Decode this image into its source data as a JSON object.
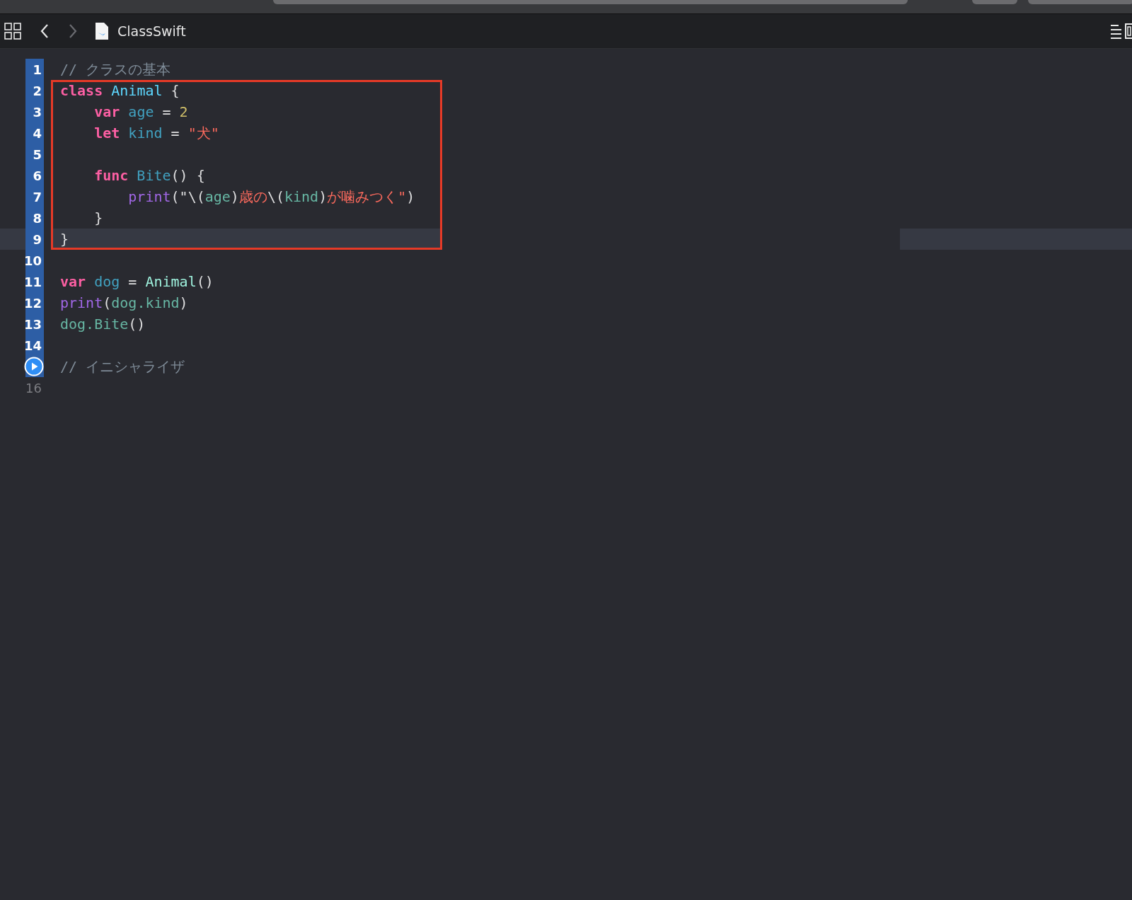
{
  "toolbar": {
    "back_disabled": false,
    "forward_disabled": true,
    "file_name": "ClassSwift"
  },
  "editor": {
    "blocks": [
      {
        "boxed": false,
        "lines": [
          {
            "number": "1",
            "selected": true,
            "current": false,
            "run_marker": false,
            "tokens": [
              {
                "kind": "comment",
                "text": "// クラスの基本"
              }
            ]
          }
        ]
      },
      {
        "boxed": true,
        "lines": [
          {
            "number": "2",
            "selected": true,
            "current": false,
            "run_marker": false,
            "tokens": [
              {
                "kind": "keyword",
                "text": "class"
              },
              {
                "kind": "type_decl",
                "text": " Animal"
              },
              {
                "kind": "plain",
                "text": " {"
              }
            ]
          },
          {
            "number": "3",
            "selected": true,
            "current": false,
            "run_marker": false,
            "tokens": [
              {
                "kind": "keyword",
                "text": "    var"
              },
              {
                "kind": "decl",
                "text": " age"
              },
              {
                "kind": "plain",
                "text": " = "
              },
              {
                "kind": "number",
                "text": "2"
              }
            ]
          },
          {
            "number": "4",
            "selected": true,
            "current": false,
            "run_marker": false,
            "tokens": [
              {
                "kind": "keyword",
                "text": "    let"
              },
              {
                "kind": "decl",
                "text": " kind"
              },
              {
                "kind": "plain",
                "text": " = "
              },
              {
                "kind": "string",
                "text": "\"犬\""
              }
            ]
          },
          {
            "number": "5",
            "selected": true,
            "current": false,
            "run_marker": false
          },
          {
            "number": "6",
            "selected": true,
            "current": false,
            "run_marker": false,
            "tokens": [
              {
                "kind": "keyword",
                "text": "    func"
              },
              {
                "kind": "decl",
                "text": " Bite"
              },
              {
                "kind": "plain",
                "text": "() {"
              }
            ]
          },
          {
            "number": "7",
            "selected": true,
            "current": false,
            "run_marker": false,
            "tokens": [
              {
                "kind": "call",
                "text": "        print"
              },
              {
                "kind": "plain",
                "text": "(\"\\("
              },
              {
                "kind": "reference",
                "text": "age"
              },
              {
                "kind": "plain",
                "text": ")"
              },
              {
                "kind": "string",
                "text": "歳の"
              },
              {
                "kind": "plain",
                "text": "\\("
              },
              {
                "kind": "reference",
                "text": "kind"
              },
              {
                "kind": "plain",
                "text": ")"
              },
              {
                "kind": "string",
                "text": "が噛みつく\""
              },
              {
                "kind": "plain",
                "text": ")"
              }
            ]
          },
          {
            "number": "8",
            "selected": true,
            "current": false,
            "run_marker": false,
            "tokens": [
              {
                "kind": "plain",
                "text": "    }"
              }
            ]
          },
          {
            "number": "9",
            "selected": true,
            "current": true,
            "run_marker": false,
            "tokens": [
              {
                "kind": "plain",
                "text": "}"
              }
            ]
          }
        ]
      },
      {
        "boxed": false,
        "lines": [
          {
            "number": "10",
            "selected": true,
            "current": false,
            "run_marker": false
          },
          {
            "number": "11",
            "selected": true,
            "current": false,
            "run_marker": false,
            "tokens": [
              {
                "kind": "keyword",
                "text": "var"
              },
              {
                "kind": "decl",
                "text": " dog"
              },
              {
                "kind": "plain",
                "text": " = "
              },
              {
                "kind": "type",
                "text": "Animal"
              },
              {
                "kind": "plain",
                "text": "()"
              }
            ]
          },
          {
            "number": "12",
            "selected": true,
            "current": false,
            "run_marker": false,
            "tokens": [
              {
                "kind": "call",
                "text": "print"
              },
              {
                "kind": "plain",
                "text": "("
              },
              {
                "kind": "reference",
                "text": "dog.kind"
              },
              {
                "kind": "plain",
                "text": ")"
              }
            ]
          },
          {
            "number": "13",
            "selected": true,
            "current": false,
            "run_marker": false,
            "tokens": [
              {
                "kind": "reference",
                "text": "dog.Bite"
              },
              {
                "kind": "plain",
                "text": "()"
              }
            ]
          },
          {
            "number": "14",
            "selected": true,
            "current": false,
            "run_marker": false
          },
          {
            "selected": true,
            "current": false,
            "run_marker": true,
            "tokens": [
              {
                "kind": "comment",
                "text": "// イニシャライザ"
              }
            ]
          },
          {
            "number": "16",
            "selected": false,
            "current": false,
            "run_marker": false
          }
        ]
      }
    ]
  }
}
